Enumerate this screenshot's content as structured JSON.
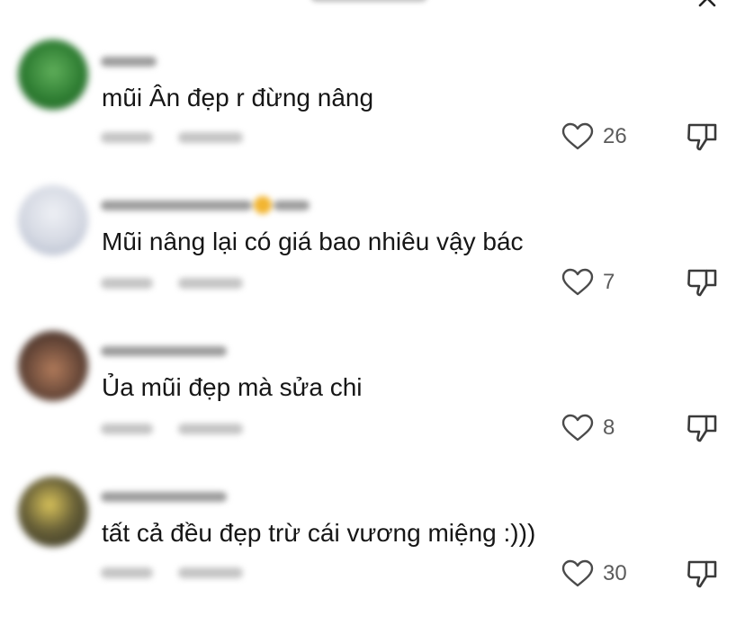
{
  "comments": [
    {
      "text": "mũi Ân đẹp r đừng nâng",
      "likes": "26",
      "avatar_color": "#2e7d32"
    },
    {
      "text": "Mũi nâng lại có giá bao nhiêu vậy bác",
      "likes": "7",
      "avatar_color": "#d9dde6"
    },
    {
      "text": "Ủa mũi đẹp mà sửa chi",
      "likes": "8",
      "avatar_color": "#6b4a3a"
    },
    {
      "text": "tất cả đều đẹp trừ cái vương miệng :)))",
      "likes": "30",
      "avatar_color": "#4a4a32"
    }
  ],
  "icons": {
    "like": "heart-outline-icon",
    "dislike": "thumbs-down-icon",
    "close": "close-icon"
  },
  "colors": {
    "text": "#161616",
    "count": "#5b5b5b",
    "icon": "#444444"
  }
}
